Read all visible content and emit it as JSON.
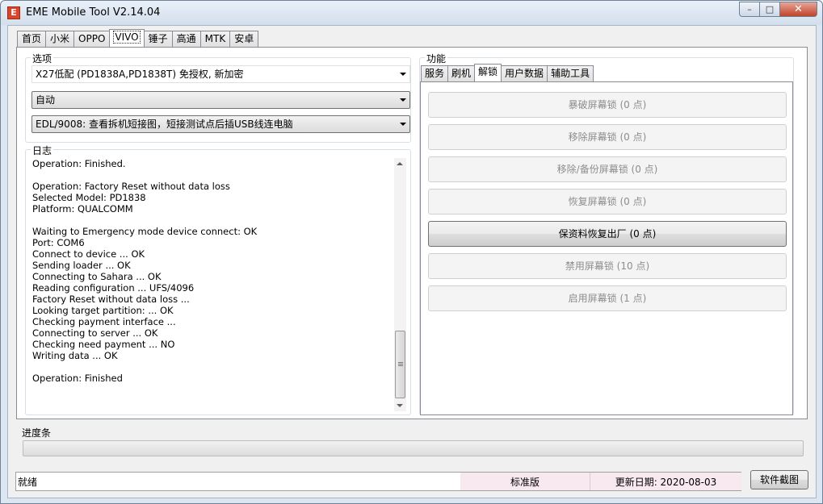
{
  "window": {
    "app_icon_glyph": "E",
    "title": "EME Mobile Tool V2.14.04",
    "minimize_glyph": "–",
    "maximize_glyph": "□",
    "close_glyph": "✕"
  },
  "main_tabs": [
    "首页",
    "小米",
    "OPPO",
    "VIVO",
    "锤子",
    "高通",
    "MTK",
    "安卓"
  ],
  "active_main_tab": "VIVO",
  "options": {
    "label": "选项",
    "model_select": "X27低配 (PD1838A,PD1838T) 免授权, 新加密",
    "mode_select": "自动",
    "method_select": "EDL/9008: 查看拆机短接图，短接测试点后插USB线连电脑"
  },
  "log": {
    "label": "日志",
    "lines": [
      "Operation: Finished.",
      "",
      "Operation: Factory Reset without data loss",
      "Selected Model: PD1838",
      "Platform: QUALCOMM",
      "",
      "Waiting to Emergency mode device connect: OK",
      "Port: COM6",
      "Connect to device ... OK",
      "Sending loader ... OK",
      "Connecting to Sahara ... OK",
      "Reading configuration ... UFS/4096",
      "Factory Reset without data loss ...",
      "Looking target partition: ... OK",
      "Checking payment interface ...",
      "Connecting to server ... OK",
      "Checking need payment ... NO",
      "Writing data ... OK",
      "",
      "Operation: Finished"
    ]
  },
  "functions": {
    "label": "功能",
    "sub_tabs": [
      "服务",
      "刷机",
      "解锁",
      "用户数据",
      "辅助工具"
    ],
    "active_sub_tab": "解锁",
    "buttons": [
      {
        "label": "暴破屏幕锁 (0 点)",
        "enabled": false
      },
      {
        "label": "移除屏幕锁 (0 点)",
        "enabled": false
      },
      {
        "label": "移除/备份屏幕锁 (0 点)",
        "enabled": false
      },
      {
        "label": "恢复屏幕锁 (0 点)",
        "enabled": false
      },
      {
        "label": "保资料恢复出厂 (0 点)",
        "enabled": true
      },
      {
        "label": "禁用屏幕锁 (10 点)",
        "enabled": false
      },
      {
        "label": "启用屏幕锁 (1 点)",
        "enabled": false
      }
    ]
  },
  "progress": {
    "label": "进度条",
    "value": 0
  },
  "status": {
    "text": "就绪",
    "edition": "标准版",
    "update_date": "更新日期: 2020-08-03",
    "edition_bg": "#f8e8f0"
  },
  "screenshot_button": "软件截图"
}
